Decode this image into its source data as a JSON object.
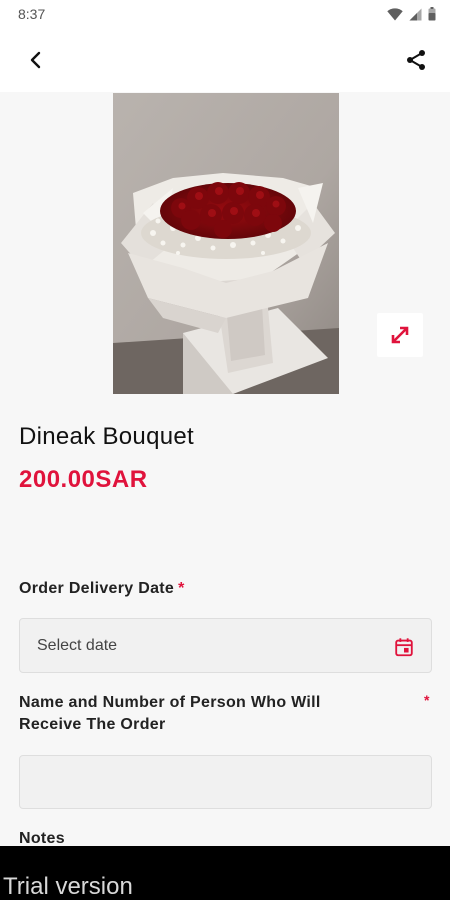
{
  "status_bar": {
    "time": "8:37",
    "icons": [
      "wifi-icon",
      "signal-icon",
      "battery-icon"
    ]
  },
  "app_bar": {
    "back_icon": "back-arrow-icon",
    "share_icon": "share-icon"
  },
  "product": {
    "name": "Dineak Bouquet",
    "price": "200.00SAR",
    "image_subject": "red rose bouquet"
  },
  "form": {
    "delivery_date": {
      "label": "Order Delivery Date",
      "required_mark": "*",
      "placeholder": "Select date"
    },
    "recipient": {
      "label": "Name and Number of Person Who Will Receive The Order",
      "required_mark": "*",
      "value": ""
    },
    "notes": {
      "label": "Notes"
    }
  },
  "watermark": {
    "text": "Trial version"
  },
  "colors": {
    "accent": "#e0133c",
    "background": "#f7f7f7",
    "surface": "#ffffff"
  }
}
